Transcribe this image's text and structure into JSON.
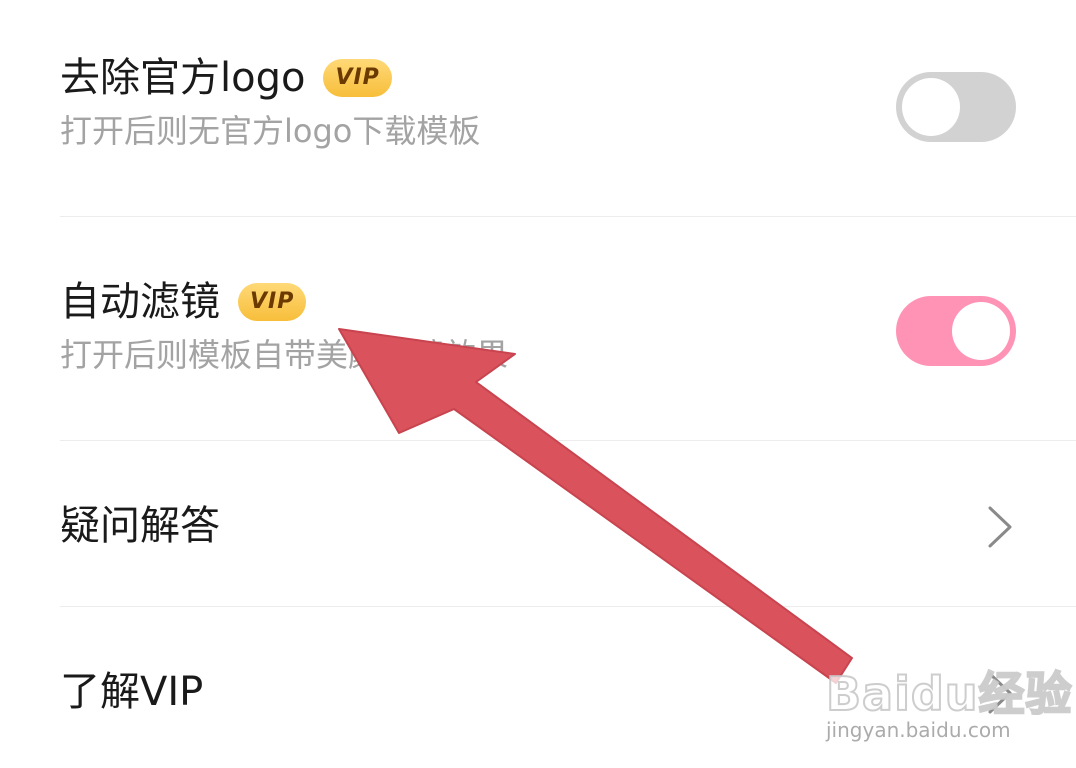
{
  "settings": {
    "remove_logo": {
      "title": "去除官方logo",
      "badge": "VIP",
      "subtitle": "打开后则无官方logo下载模板",
      "enabled": false
    },
    "auto_filter": {
      "title": "自动滤镜",
      "badge": "VIP",
      "subtitle": "打开后则模板自带美颜滤镜效果",
      "enabled": true
    },
    "faq": {
      "title": "疑问解答"
    },
    "about_vip": {
      "title": "了解VIP"
    }
  },
  "colors": {
    "toggle_on": "#ff93b6",
    "toggle_off": "#d2d2d2",
    "vip_badge": "#f7be3a",
    "annotation_arrow": "#d9525c"
  },
  "watermark": {
    "logo": "Baidu经验",
    "url": "jingyan.baidu.com"
  }
}
